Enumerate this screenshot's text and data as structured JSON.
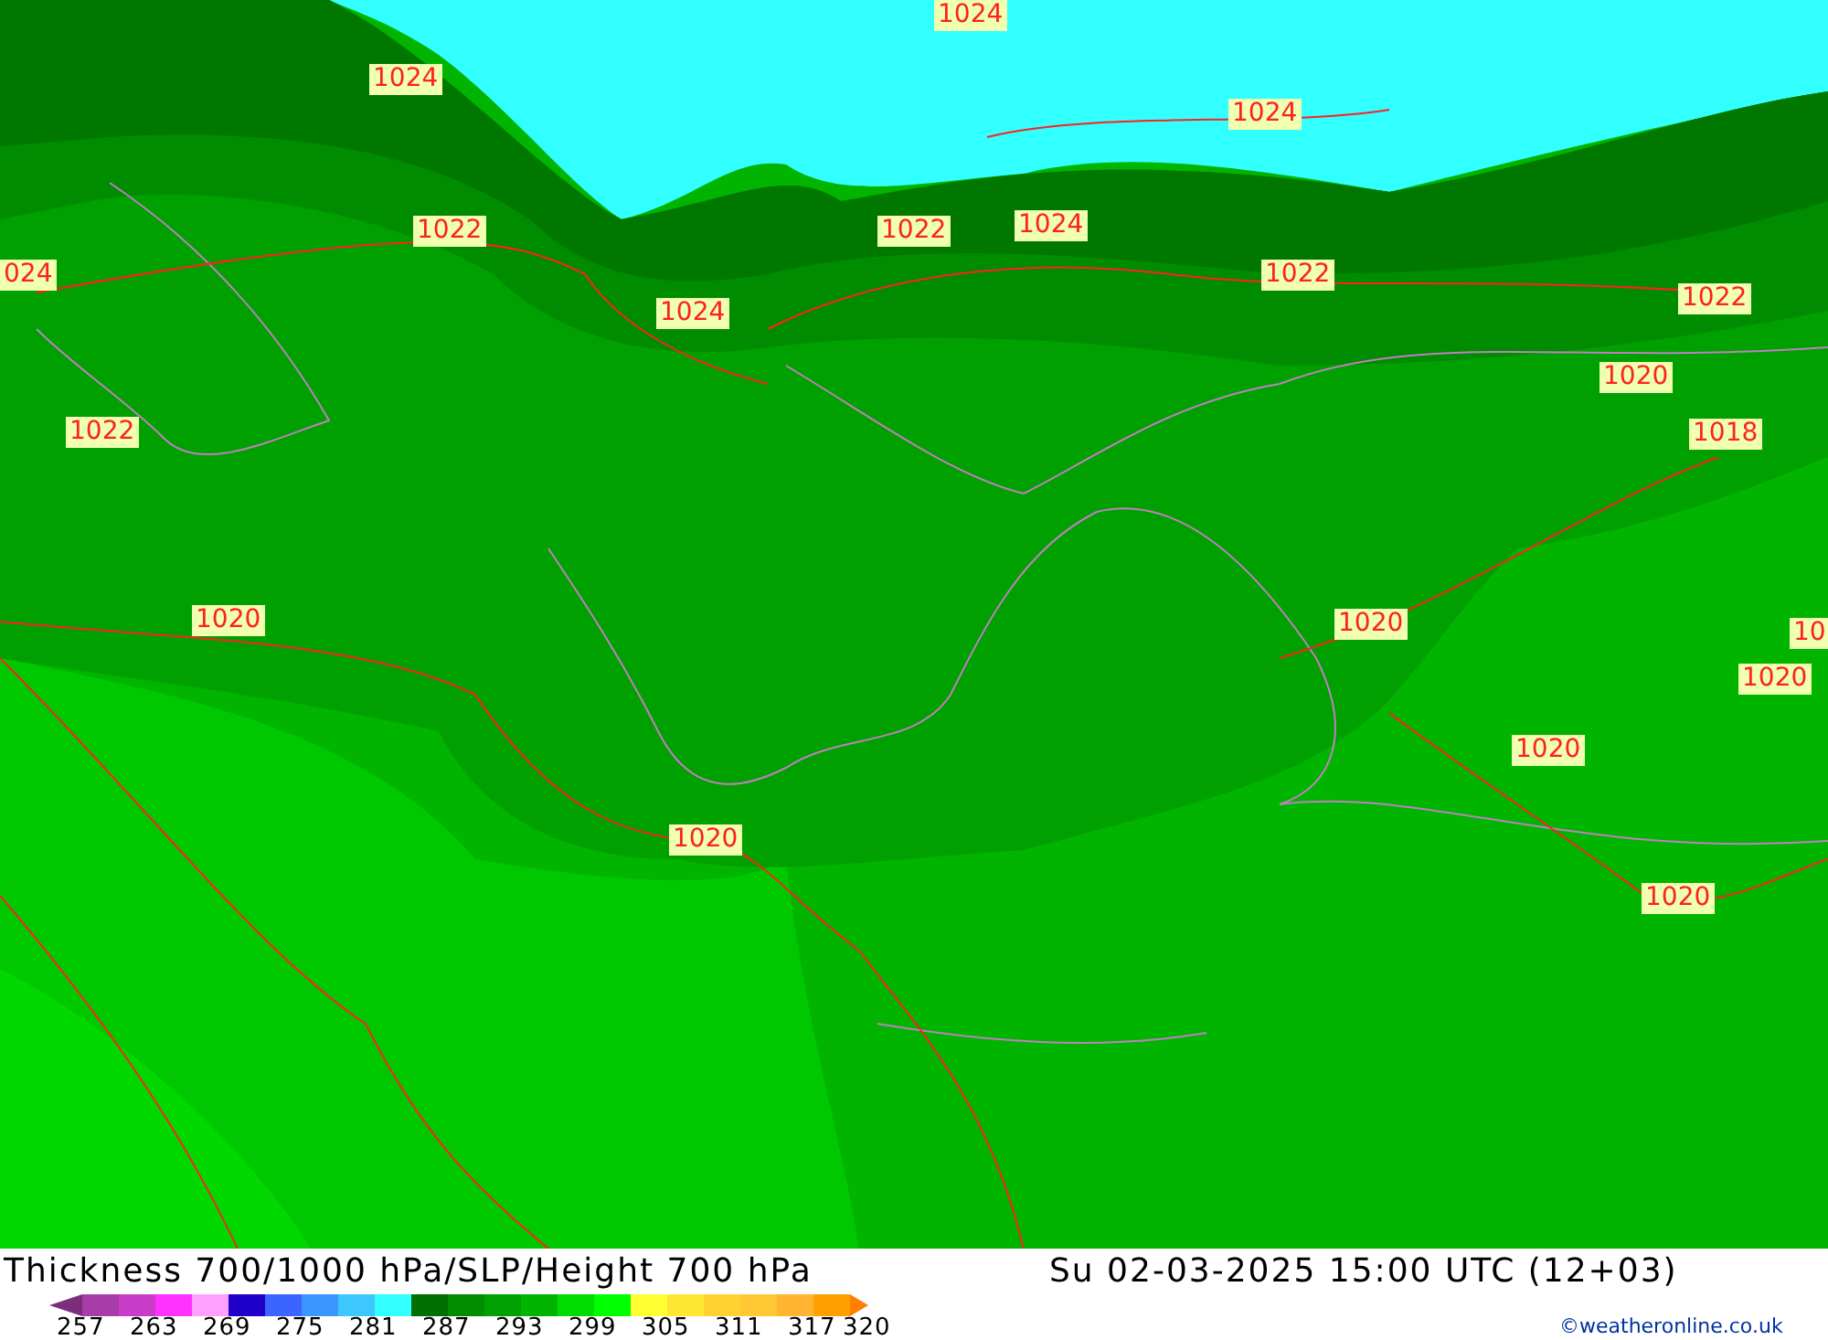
{
  "map": {
    "isobar_labels": [
      {
        "text": "1024"
      },
      {
        "text": "1024"
      },
      {
        "text": "1024"
      },
      {
        "text": "1022"
      },
      {
        "text": "1022"
      },
      {
        "text": "1024"
      },
      {
        "text": "024"
      },
      {
        "text": "1022"
      },
      {
        "text": "1022"
      },
      {
        "text": "1024"
      },
      {
        "text": "1020"
      },
      {
        "text": "1022"
      },
      {
        "text": "1018"
      },
      {
        "text": "1020"
      },
      {
        "text": "1020"
      },
      {
        "text": "10"
      },
      {
        "text": "1020"
      },
      {
        "text": "1020"
      },
      {
        "text": "1020"
      },
      {
        "text": "1020"
      }
    ]
  },
  "footer": {
    "title": "Thickness 700/1000 hPa/SLP/Height 700 hPa",
    "datetime": "Su 02-03-2025 15:00 UTC (12+03)",
    "credit": "©weatheronline.co.uk",
    "legend": {
      "swatches": [
        {
          "color": "#a83ca8"
        },
        {
          "color": "#c83cc8"
        },
        {
          "color": "#ff32ff"
        },
        {
          "color": "#ffa0ff"
        },
        {
          "color": "#1e00c8"
        },
        {
          "color": "#3c64ff"
        },
        {
          "color": "#3c96ff"
        },
        {
          "color": "#3cc8ff"
        },
        {
          "color": "#32ffff"
        },
        {
          "color": "#006e00"
        },
        {
          "color": "#008c00"
        },
        {
          "color": "#00a000"
        },
        {
          "color": "#00b400"
        },
        {
          "color": "#00dc00"
        },
        {
          "color": "#00ff00"
        },
        {
          "color": "#ffff32"
        },
        {
          "color": "#ffe632"
        },
        {
          "color": "#ffd232"
        },
        {
          "color": "#ffc832"
        },
        {
          "color": "#ffb432"
        },
        {
          "color": "#ffa000"
        }
      ],
      "ticks": [
        "257",
        "263",
        "269",
        "275",
        "281",
        "287",
        "293",
        "299",
        "305",
        "311",
        "317",
        "320"
      ]
    }
  }
}
